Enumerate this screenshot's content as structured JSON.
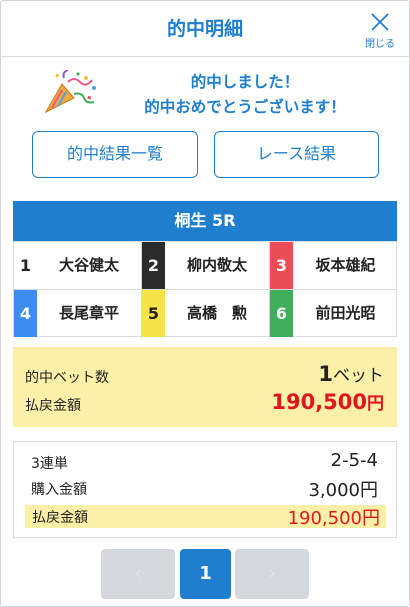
{
  "header": {
    "title": "的中明細",
    "close_label": "閉じる"
  },
  "message": {
    "line1": "的中しました！",
    "line2": "的中おめでとうございます！"
  },
  "buttons": {
    "results_list": "的中結果一覧",
    "race_results": "レース結果"
  },
  "race": {
    "title": "桐生 5R",
    "racers": [
      {
        "num": "1",
        "name": "大谷健太",
        "bg": "#ffffff",
        "fg": "#222222"
      },
      {
        "num": "2",
        "name": "柳内敬太",
        "bg": "#2b2b2b",
        "fg": "#ffffff"
      },
      {
        "num": "3",
        "name": "坂本雄紀",
        "bg": "#ea4d55",
        "fg": "#ffffff"
      },
      {
        "num": "4",
        "name": "長尾章平",
        "bg": "#3d8df0",
        "fg": "#ffffff"
      },
      {
        "num": "5",
        "name": "高橋　勲",
        "bg": "#f7e24a",
        "fg": "#222222"
      },
      {
        "num": "6",
        "name": "前田光昭",
        "bg": "#3fae5a",
        "fg": "#ffffff"
      }
    ]
  },
  "summary": {
    "bets_label": "的中ベット数",
    "bets_count": "1",
    "bets_unit": "ベット",
    "payout_label": "払戻金額",
    "payout_value": "190,500",
    "payout_unit": "円"
  },
  "detail": {
    "bet_type": "3連単",
    "combination": "2-5-4",
    "purchase_label": "購入金額",
    "purchase_value": "3,000円",
    "payout_label": "払戻金額",
    "payout_value": "190,500円"
  },
  "pager": {
    "prev": "‹",
    "current": "1",
    "next": "›"
  },
  "colors": {
    "accent": "#1f7fce",
    "highlight": "#fcefa8",
    "payout": "#e0161e"
  }
}
